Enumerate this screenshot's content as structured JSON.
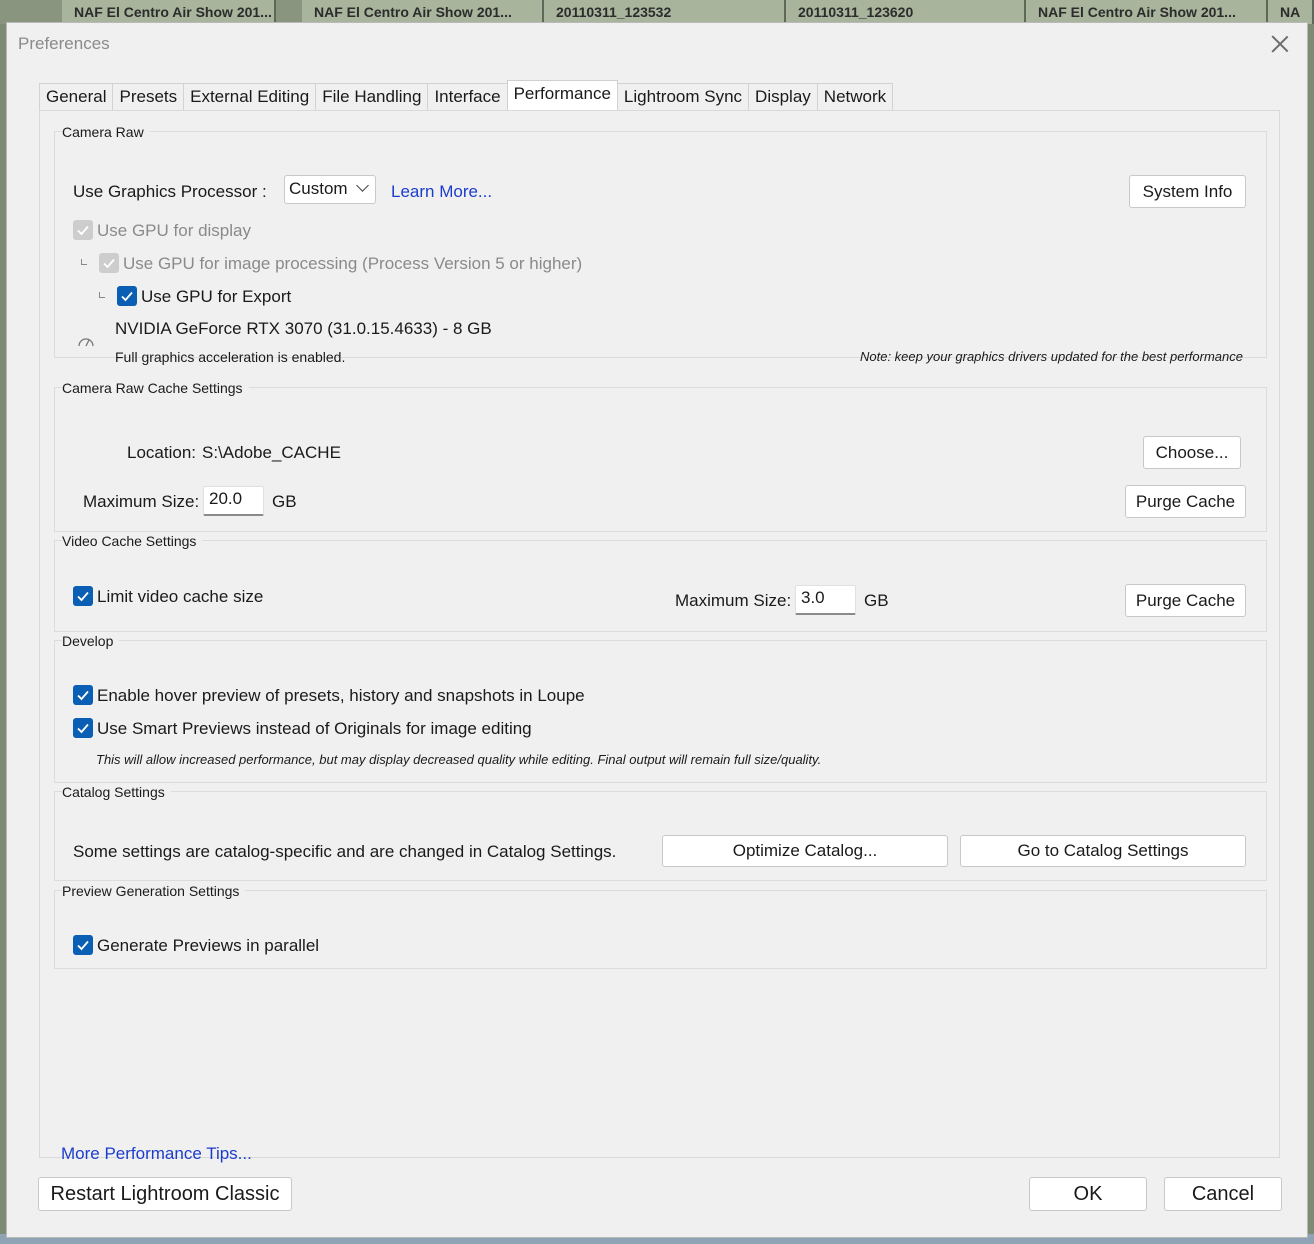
{
  "background": {
    "filmstrip": [
      "NAF El Centro Air Show 201...",
      "NAF El Centro Air Show 201...",
      "20110311_123532",
      "20110311_123620",
      "NAF El Centro Air Show 201...",
      "NA"
    ]
  },
  "dialog": {
    "title": "Preferences"
  },
  "tabs": [
    {
      "label": "General",
      "active": false
    },
    {
      "label": "Presets",
      "active": false
    },
    {
      "label": "External Editing",
      "active": false
    },
    {
      "label": "File Handling",
      "active": false
    },
    {
      "label": "Interface",
      "active": false
    },
    {
      "label": "Performance",
      "active": true
    },
    {
      "label": "Lightroom Sync",
      "active": false
    },
    {
      "label": "Display",
      "active": false
    },
    {
      "label": "Network",
      "active": false
    }
  ],
  "camera_raw": {
    "section_title": "Camera Raw",
    "gpu_label": "Use Graphics Processor :",
    "gpu_select": "Custom",
    "learn_more": "Learn More...",
    "system_info_button": "System Info",
    "use_gpu_display": "Use GPU for display",
    "use_gpu_processing": "Use GPU for image processing (Process Version 5 or higher)",
    "use_gpu_export": "Use GPU for Export",
    "gpu_name": "NVIDIA GeForce RTX 3070 (31.0.15.4633) - 8 GB",
    "acceleration_status": "Full graphics acceleration is enabled.",
    "driver_note": "Note: keep your graphics drivers updated for the best performance"
  },
  "cache": {
    "section_title": "Camera Raw Cache Settings",
    "location_label": "Location:",
    "location_value": "S:\\Adobe_CACHE",
    "choose_button": "Choose...",
    "max_size_label": "Maximum Size:",
    "max_size_value": "20.0",
    "max_size_unit": "GB",
    "purge_button": "Purge Cache"
  },
  "video_cache": {
    "section_title": "Video Cache Settings",
    "limit_label": "Limit video cache size",
    "max_size_label": "Maximum Size:",
    "max_size_value": "3.0",
    "max_size_unit": "GB",
    "purge_button": "Purge Cache"
  },
  "develop": {
    "section_title": "Develop",
    "hover_preview": "Enable hover preview of presets, history and snapshots in Loupe",
    "smart_previews": "Use Smart Previews instead of Originals for image editing",
    "smart_previews_note": "This will allow increased performance, but may display decreased quality while editing. Final output will remain full size/quality."
  },
  "catalog": {
    "section_title": "Catalog Settings",
    "description": "Some settings are catalog-specific and are changed in Catalog Settings.",
    "optimize_button": "Optimize Catalog...",
    "goto_button": "Go to Catalog Settings"
  },
  "preview": {
    "section_title": "Preview Generation Settings",
    "parallel_label": "Generate Previews in parallel"
  },
  "more_tips": "More Performance Tips...",
  "footer": {
    "restart_button": "Restart Lightroom Classic",
    "ok_button": "OK",
    "cancel_button": "Cancel"
  },
  "colors": {
    "checkbox_accent": "#0a5fb4",
    "link": "#1c3dcb",
    "dialog_bg": "#f0f0f0"
  }
}
